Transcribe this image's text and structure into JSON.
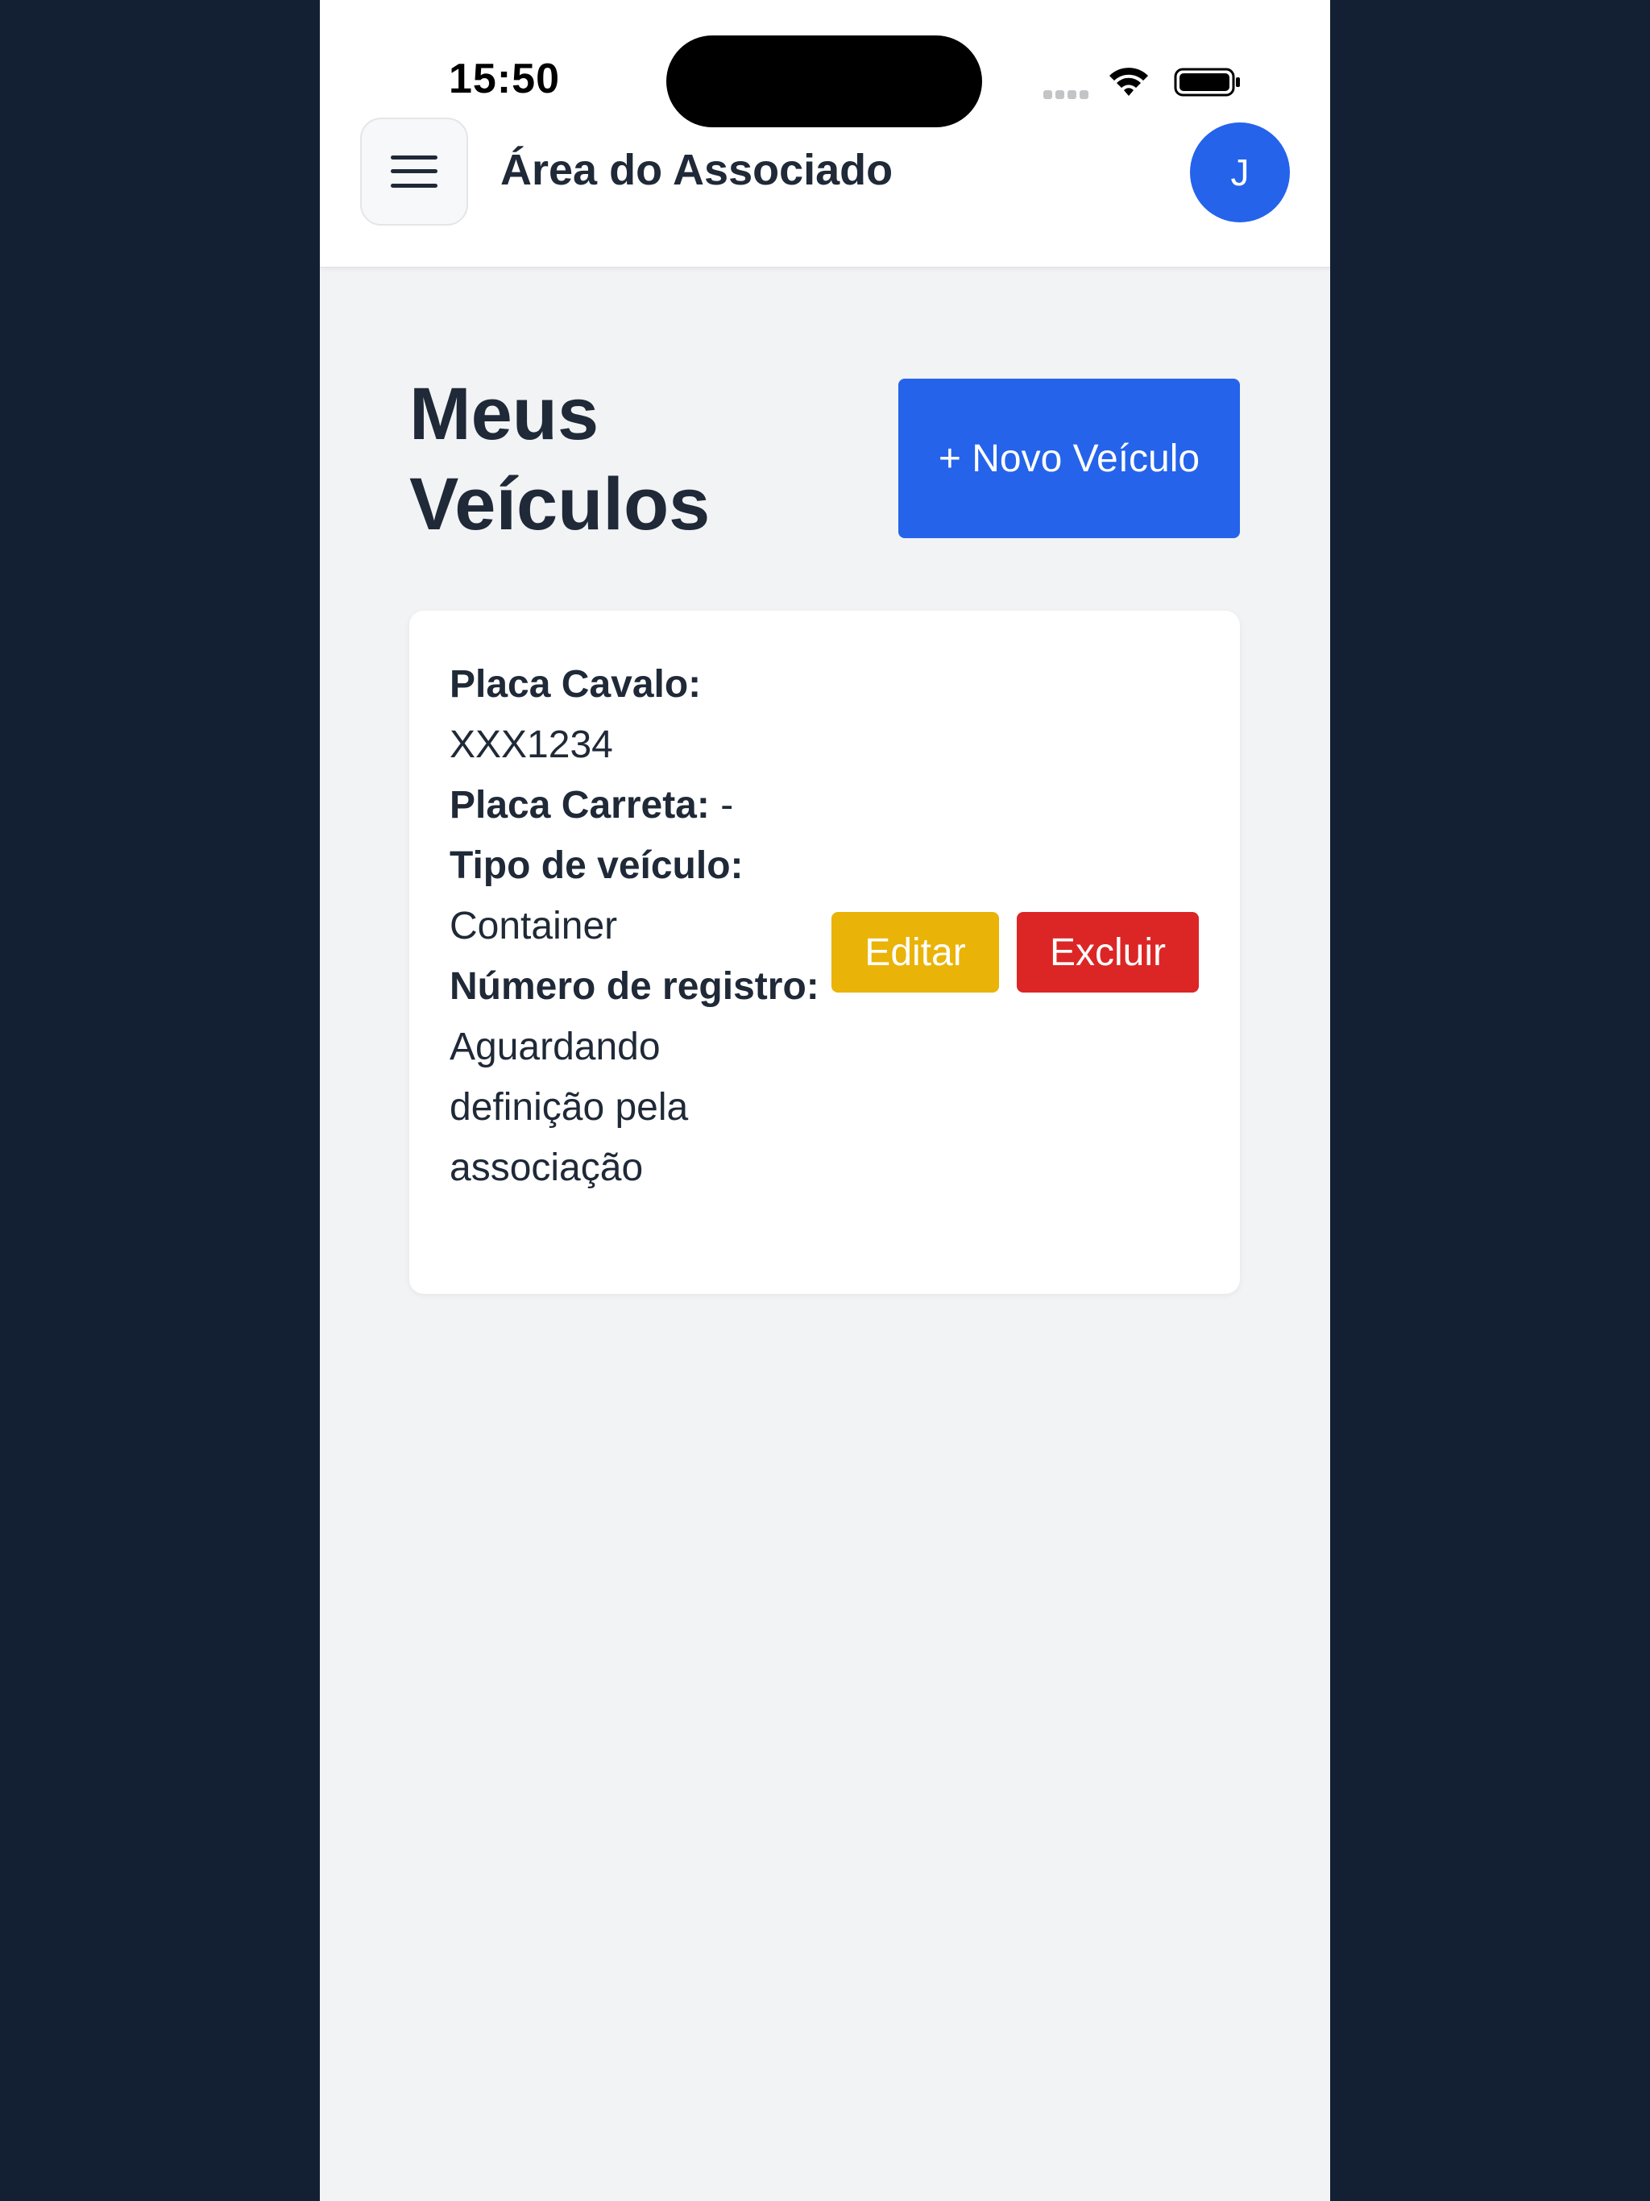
{
  "status_bar": {
    "time": "15:50"
  },
  "header": {
    "menu_icon": "hamburger-menu-icon",
    "title": "Área do Associado",
    "avatar_initial": "J"
  },
  "main": {
    "page_title": "Meus Veículos",
    "new_vehicle_button": "+ Novo Veículo",
    "vehicles": [
      {
        "placa_cavalo_label": "Placa Cavalo:",
        "placa_cavalo_value": "XXX1234",
        "placa_carreta_label": "Placa Carreta:",
        "placa_carreta_value": "-",
        "tipo_label": "Tipo de veículo:",
        "tipo_value": "Container",
        "registro_label": "Número de registro:",
        "registro_value": "Aguardando definição pela associação",
        "edit_label": "Editar",
        "delete_label": "Excluir"
      }
    ]
  },
  "colors": {
    "background": "#131f33",
    "primary": "#2563eb",
    "edit": "#eab308",
    "delete": "#dc2626",
    "text": "#1f2937"
  }
}
